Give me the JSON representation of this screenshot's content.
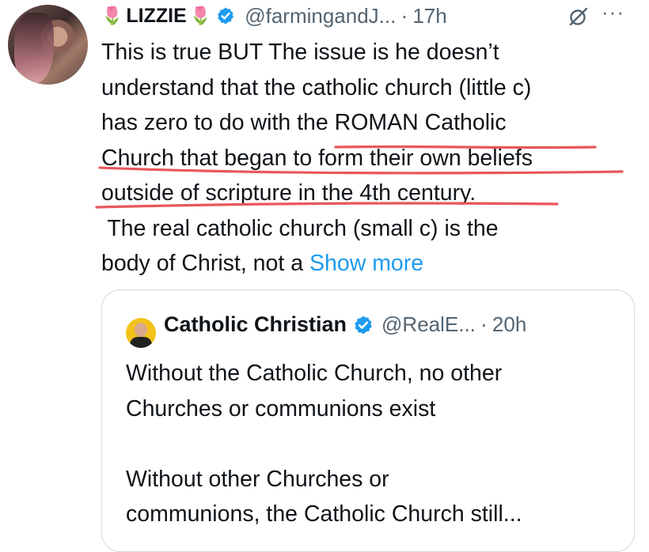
{
  "tweet": {
    "display_name": "LIZZIE",
    "handle": "@farmingandJ...",
    "separator": "·",
    "time": "17h",
    "body_lines": [
      "This is true BUT The issue is he doesn’t",
      "understand that the catholic church (little c)",
      "has zero to do with the ROMAN Catholic",
      "Church that began to form their own beliefs",
      "outside of scripture in the 4th century.",
      " The real catholic church (small c) is the"
    ],
    "last_line_text": "body of Christ, not a ",
    "show_more_label": "Show more",
    "underline_color": "#e8575c",
    "icons": [
      "tulip-icon",
      "verified-badge-icon",
      "grok-icon",
      "more-options-icon"
    ]
  },
  "quote": {
    "display_name": "Catholic Christian",
    "handle": "@RealE...",
    "separator": "·",
    "time": "20h",
    "paragraph1": [
      "Without the Catholic Church, no other",
      "Churches or communions exist"
    ],
    "paragraph2": [
      "Without other Churches or",
      "communions, the Catholic Church still..."
    ]
  },
  "colors": {
    "text": "#0f1419",
    "secondary": "#536471",
    "link": "#1d9bf0",
    "verified": "#1d9bf0",
    "border": "#cfd9de"
  }
}
